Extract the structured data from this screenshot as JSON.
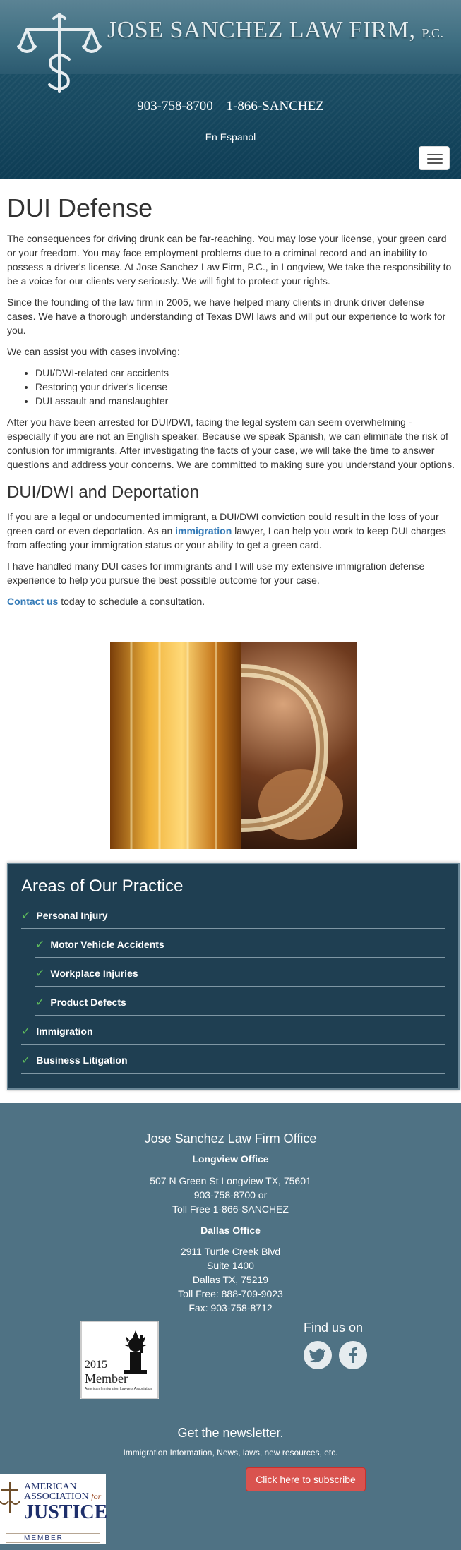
{
  "header": {
    "firm_name": "JOSE SANCHEZ LAW FIRM",
    "firm_suffix": "P.C.",
    "phone_local": "903-758-8700",
    "phone_tollfree": "1-866-SANCHEZ",
    "espanol_link": "En Espanol",
    "colors": {
      "header_bg": "#0e3d55"
    }
  },
  "main": {
    "title": "DUI Defense",
    "p1": "The consequences for driving drunk can be far-reaching. You may lose your license, your green card or your freedom. You may face employment problems due to a criminal record and an inability to possess a driver's license. At Jose Sanchez Law Firm, P.C., in Longview, We take the responsibility to be a voice for our clients very seriously. We will fight to protect your rights.",
    "p2": "Since the founding of the law firm in 2005, we have helped many clients in drunk driver defense cases. We have a thorough understanding of Texas DWI laws and will put our experience to work for you.",
    "p3": "We can assist you with cases involving:",
    "list": [
      "DUI/DWI-related car accidents",
      "Restoring your driver's license",
      "DUI assault and manslaughter"
    ],
    "p4": "After you have been arrested for DUI/DWI, facing the legal system can seem overwhelming - especially if you are not an English speaker. Because we speak Spanish, we can eliminate the risk of confusion for immigrants. After investigating the facts of your case, we will take the time to answer questions and address your concerns. We are committed to making sure you understand your options.",
    "h2": "DUI/DWI and Deportation",
    "p5_a": "If you are a legal or undocumented immigrant, a DUI/DWI conviction could result in the loss of your green card or even deportation. As an ",
    "p5_link": "immigration",
    "p5_b": " lawyer, I can help you work to keep DUI charges from affecting your immigration status or your ability to get a green card.",
    "p6": "I have handled many DUI cases for immigrants and I will use my extensive immigration defense experience to help you pursue the best possible outcome for your case.",
    "p7_link": "Contact us",
    "p7_rest": " today to schedule a consultation."
  },
  "practice": {
    "title": "Areas of Our Practice",
    "items": [
      {
        "label": "Personal Injury"
      },
      {
        "label": "Motor Vehicle Accidents"
      },
      {
        "label": "Workplace Injuries"
      },
      {
        "label": "Product Defects"
      },
      {
        "label": "Immigration"
      },
      {
        "label": "Business Litigation"
      }
    ],
    "check_color": "#5cb85c"
  },
  "footer": {
    "title": "Jose Sanchez Law Firm Office",
    "longview_label": "Longview Office",
    "longview_addr": "507 N Green St Longview TX, 75601",
    "longview_phone": "903-758-8700 or",
    "longview_toll": "Toll Free 1-866-SANCHEZ",
    "dallas_label": "Dallas Office",
    "dallas_l1": "2911 Turtle Creek Blvd",
    "dallas_l2": "Suite 1400",
    "dallas_l3": "Dallas TX, 75219",
    "dallas_toll": "Toll Free: 888-709-9023",
    "dallas_fax": "Fax: 903-758-8712",
    "badge_year": "2015",
    "badge_member": "Member",
    "badge_org": "American Immigration Lawyers Association",
    "find_us": "Find us on",
    "news_title": "Get the newsletter.",
    "news_sub": "Immigration Information, News, laws, new resources, etc.",
    "subscribe_label": "Click here to subscribe",
    "aaj_line1": "AMERICAN",
    "aaj_line2": "ASSOCIATION",
    "aaj_for": "for",
    "aaj_line3": "JUSTICE",
    "aaj_member": "MEMBER",
    "colors": {
      "footer_bg": "#4f7284",
      "subscribe_bg": "#d9534f"
    }
  }
}
